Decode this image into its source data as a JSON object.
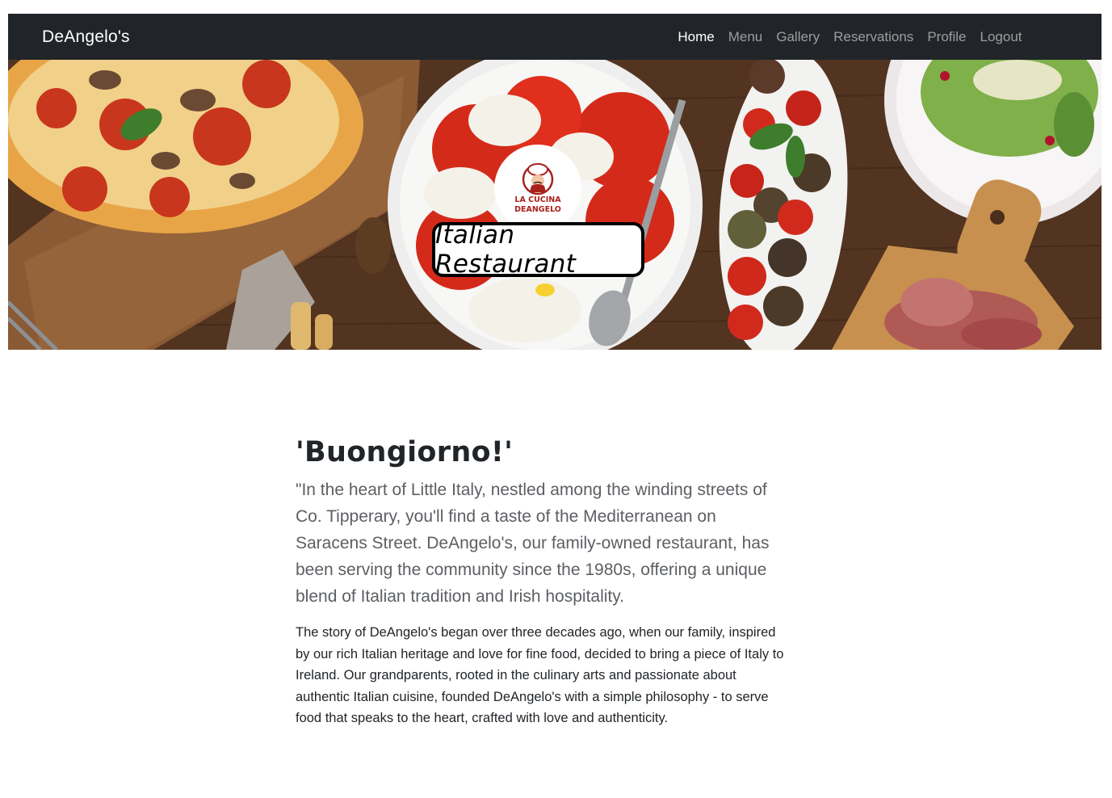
{
  "navbar": {
    "brand": "DeAngelo's",
    "links": [
      "Home",
      "Menu",
      "Gallery",
      "Reservations",
      "Profile",
      "Logout"
    ],
    "active_index": 0
  },
  "hero": {
    "logo_line1": "LA CUCINA",
    "logo_line2": "DEANGELO",
    "tagline": "Italian Restaurant"
  },
  "content": {
    "greeting": "'Buongiorno!'",
    "lead": "\"In the heart of Little Italy, nestled among the winding streets of Co. Tipperary, you'll find a taste of the Mediterranean on Saracens Street. DeAngelo's, our family-owned restaurant, has been serving the community since the 1980s, offering a unique blend of Italian tradition and Irish hospitality.",
    "story": "The story of DeAngelo's began over three decades ago, when our family, inspired by our rich Italian heritage and love for fine food, decided to bring a piece of Italy to Ireland. Our grandparents, rooted in the culinary arts and passionate about authentic Italian cuisine, founded DeAngelo's with a simple philosophy - to serve food that speaks to the heart, crafted with love and authenticity."
  },
  "colors": {
    "navbar_bg": "#212529",
    "logo_red": "#a8221e"
  }
}
